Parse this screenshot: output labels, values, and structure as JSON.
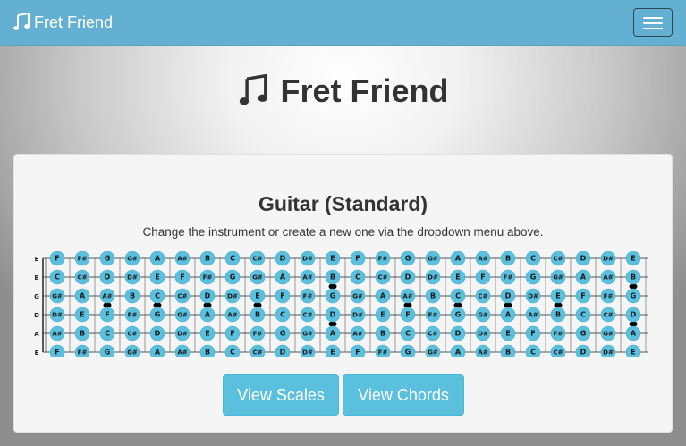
{
  "navbar": {
    "brand": "Fret Friend",
    "brand_icon": "music-note-icon",
    "toggle_icon": "hamburger-menu-icon",
    "background": "#64b0d2"
  },
  "hero": {
    "title": "Fret Friend",
    "icon": "music-note-icon"
  },
  "card": {
    "title": "Guitar (Standard)",
    "subtitle": "Change the instrument or create a new one via the dropdown menu above."
  },
  "fretboard": {
    "strings": [
      {
        "name": "E",
        "notes": [
          "F",
          "F#",
          "G",
          "G#",
          "A",
          "A#",
          "B",
          "C",
          "C#",
          "D",
          "D#",
          "E",
          "F",
          "F#",
          "G",
          "G#",
          "A",
          "A#",
          "B",
          "C",
          "C#",
          "D",
          "D#",
          "E"
        ]
      },
      {
        "name": "B",
        "notes": [
          "C",
          "C#",
          "D",
          "D#",
          "E",
          "F",
          "F#",
          "G",
          "G#",
          "A",
          "A#",
          "B",
          "C",
          "C#",
          "D",
          "D#",
          "E",
          "F",
          "F#",
          "G",
          "G#",
          "A",
          "A#",
          "B"
        ]
      },
      {
        "name": "G",
        "notes": [
          "G#",
          "A",
          "A#",
          "B",
          "C",
          "C#",
          "D",
          "D#",
          "E",
          "F",
          "F#",
          "G",
          "G#",
          "A",
          "A#",
          "B",
          "C",
          "C#",
          "D",
          "D#",
          "E",
          "F",
          "F#",
          "G"
        ]
      },
      {
        "name": "D",
        "notes": [
          "D#",
          "E",
          "F",
          "F#",
          "G",
          "G#",
          "A",
          "A#",
          "B",
          "C",
          "C#",
          "D",
          "D#",
          "E",
          "F",
          "F#",
          "G",
          "G#",
          "A",
          "A#",
          "B",
          "C",
          "C#",
          "D"
        ]
      },
      {
        "name": "A",
        "notes": [
          "A#",
          "B",
          "C",
          "C#",
          "D",
          "D#",
          "E",
          "F",
          "F#",
          "G",
          "G#",
          "A",
          "A#",
          "B",
          "C",
          "C#",
          "D",
          "D#",
          "E",
          "F",
          "F#",
          "G",
          "G#",
          "A"
        ]
      },
      {
        "name": "E",
        "notes": [
          "F",
          "F#",
          "G",
          "G#",
          "A",
          "A#",
          "B",
          "C",
          "C#",
          "D",
          "D#",
          "E",
          "F",
          "F#",
          "G",
          "G#",
          "A",
          "A#",
          "B",
          "C",
          "C#",
          "D",
          "D#",
          "E"
        ]
      }
    ],
    "single_inlay_frets": [
      3,
      5,
      7,
      9,
      15,
      17,
      19,
      21
    ],
    "double_inlay_frets": [
      12,
      24
    ],
    "note_color": "#5bc0de",
    "inlay_color": "#000000"
  },
  "buttons": {
    "scales": "View Scales",
    "chords": "View Chords",
    "color": "#5bc0de"
  }
}
